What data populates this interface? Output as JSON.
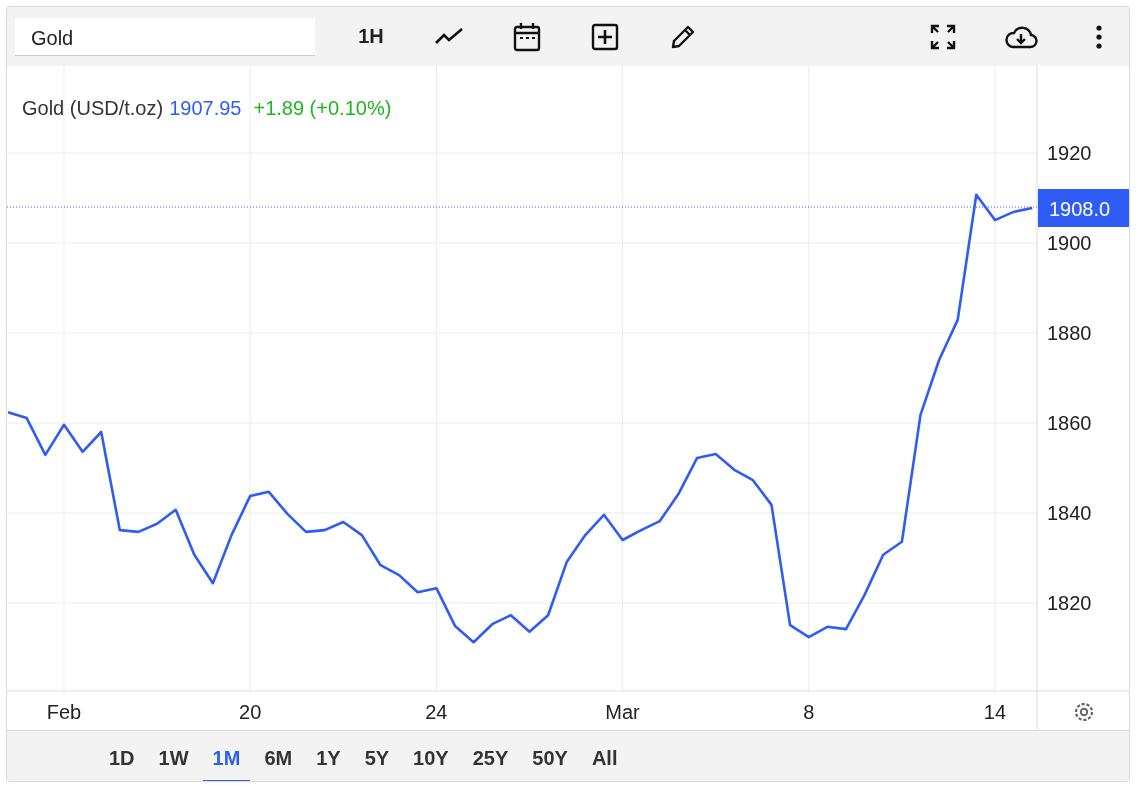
{
  "toolbar": {
    "search": {
      "value": "Gold"
    },
    "interval": "1H"
  },
  "legend": {
    "price": "1907.95",
    "change": "+1.89 (+0.10%)"
  },
  "chart": {
    "chart_data": {
      "type": "line",
      "grid": true,
      "ref_lines": [
        {
          "axis": "y",
          "value": 1908.0,
          "label": "1908.0",
          "color": "#2f5cf5"
        }
      ],
      "ylim": [
        1800,
        1940
      ],
      "categories": [
        null,
        null,
        null,
        "Feb",
        null,
        null,
        null,
        null,
        null,
        null,
        null,
        null,
        null,
        "20",
        null,
        null,
        null,
        null,
        null,
        null,
        null,
        null,
        null,
        "24",
        null,
        null,
        null,
        null,
        null,
        null,
        null,
        null,
        null,
        "Mar",
        null,
        null,
        null,
        null,
        null,
        null,
        null,
        null,
        null,
        "8",
        null,
        null,
        null,
        null,
        null,
        null,
        null,
        null,
        null,
        "14",
        null,
        null
      ],
      "yticks": [
        1820,
        1840,
        1860,
        1880,
        1900,
        1920
      ],
      "series": [
        {
          "name": "Gold (USD/t.oz)",
          "color": "#2f5cf5",
          "values": [
            1862.4,
            1861.1,
            1852.9,
            1859.6,
            1853.6,
            1858,
            1836.2,
            1835.8,
            1837.6,
            1840.7,
            1830.7,
            1824.4,
            1835.1,
            1843.8,
            1844.7,
            1839.8,
            1835.8,
            1836.2,
            1838,
            1835.1,
            1828.4,
            1826.2,
            1822.4,
            1823.3,
            1814.9,
            1811.3,
            1815.3,
            1817.3,
            1813.6,
            1817.3,
            1829.1,
            1835.1,
            1839.6,
            1834,
            1836.2,
            1838.2,
            1844.2,
            1852.2,
            1853.1,
            1849.6,
            1847.3,
            1841.8,
            1815.1,
            1812.4,
            1814.7,
            1814.2,
            1821.8,
            1830.7,
            1833.6,
            1861.8,
            1874,
            1882.9,
            1910.7,
            1905.1,
            1906.9,
            1907.8
          ]
        }
      ]
    }
  },
  "ranges": [
    {
      "label": "1D",
      "selected": false
    },
    {
      "label": "1W",
      "selected": false
    },
    {
      "label": "1M",
      "selected": true
    },
    {
      "label": "6M",
      "selected": false
    },
    {
      "label": "1Y",
      "selected": false
    },
    {
      "label": "5Y",
      "selected": false
    },
    {
      "label": "10Y",
      "selected": false
    },
    {
      "label": "25Y",
      "selected": false
    },
    {
      "label": "50Y",
      "selected": false
    },
    {
      "label": "All",
      "selected": false
    }
  ]
}
